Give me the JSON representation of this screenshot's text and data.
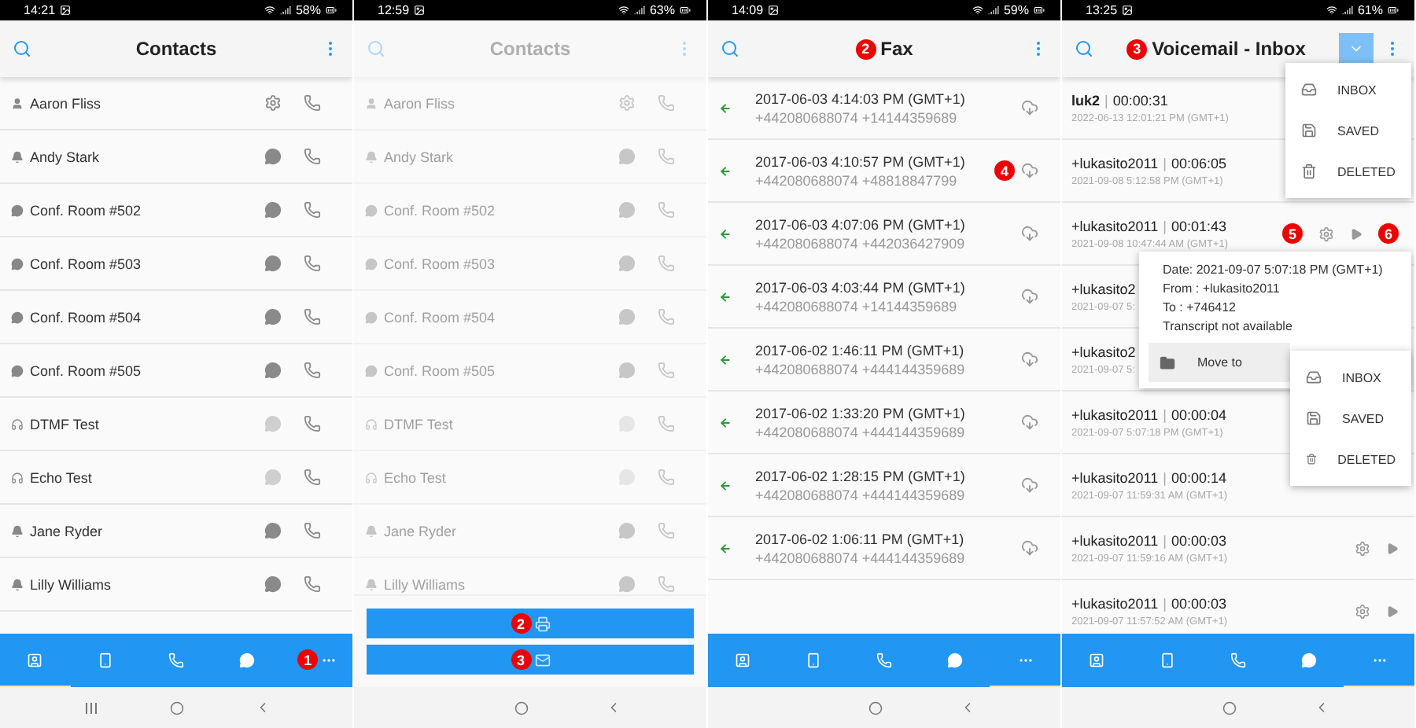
{
  "screens": [
    {
      "kind": "contacts",
      "status": {
        "time": "14:21",
        "battery": "58%"
      },
      "header": {
        "title": "Contacts"
      },
      "dimmed": false,
      "contacts": [
        {
          "name": "Aaron Fliss",
          "kind": "person",
          "action": {
            "kind": "settings",
            "enabled": true
          }
        },
        {
          "name": "Andy Stark",
          "kind": "bell",
          "action": {
            "kind": "chat",
            "enabled": true
          }
        },
        {
          "name": "Conf. Room #502",
          "kind": "chat",
          "action": {
            "kind": "chat",
            "enabled": true
          }
        },
        {
          "name": "Conf. Room #503",
          "kind": "chat",
          "action": {
            "kind": "chat",
            "enabled": true
          }
        },
        {
          "name": "Conf. Room #504",
          "kind": "chat",
          "action": {
            "kind": "chat",
            "enabled": true
          }
        },
        {
          "name": "Conf. Room #505",
          "kind": "chat",
          "action": {
            "kind": "chat",
            "enabled": true
          }
        },
        {
          "name": "DTMF Test",
          "kind": "headset",
          "action": {
            "kind": "chat",
            "enabled": false
          }
        },
        {
          "name": "Echo Test",
          "kind": "headset",
          "action": {
            "kind": "chat",
            "enabled": false
          }
        },
        {
          "name": "Jane Ryder",
          "kind": "bell",
          "action": {
            "kind": "chat",
            "enabled": true
          }
        },
        {
          "name": "Lilly Williams",
          "kind": "bell",
          "action": {
            "kind": "chat",
            "enabled": true
          }
        }
      ],
      "nav": [
        {
          "kind": "contacts",
          "selected": true
        },
        {
          "kind": "mobile",
          "selected": false
        },
        {
          "kind": "calls",
          "selected": false
        },
        {
          "kind": "chat",
          "selected": false
        },
        {
          "kind": "more",
          "selected": false,
          "badge": "1"
        }
      ],
      "system_nav": {
        "recents": true
      }
    },
    {
      "kind": "contacts",
      "status": {
        "time": "12:59",
        "battery": "63%"
      },
      "header": {
        "title": "Contacts"
      },
      "dimmed": true,
      "contacts": [
        {
          "name": "Aaron Fliss",
          "kind": "person",
          "action": {
            "kind": "settings",
            "enabled": true
          }
        },
        {
          "name": "Andy Stark",
          "kind": "bell",
          "action": {
            "kind": "chat",
            "enabled": true
          }
        },
        {
          "name": "Conf. Room #502",
          "kind": "chat",
          "action": {
            "kind": "chat",
            "enabled": true
          }
        },
        {
          "name": "Conf. Room #503",
          "kind": "chat",
          "action": {
            "kind": "chat",
            "enabled": true
          }
        },
        {
          "name": "Conf. Room #504",
          "kind": "chat",
          "action": {
            "kind": "chat",
            "enabled": true
          }
        },
        {
          "name": "Conf. Room #505",
          "kind": "chat",
          "action": {
            "kind": "chat",
            "enabled": true
          }
        },
        {
          "name": "DTMF Test",
          "kind": "headset",
          "action": {
            "kind": "chat",
            "enabled": false
          }
        },
        {
          "name": "Echo Test",
          "kind": "headset",
          "action": {
            "kind": "chat",
            "enabled": false
          }
        },
        {
          "name": "Jane Ryder",
          "kind": "bell",
          "action": {
            "kind": "chat",
            "enabled": true
          }
        },
        {
          "name": "Lilly Williams",
          "kind": "bell",
          "action": {
            "kind": "chat",
            "enabled": true
          }
        }
      ],
      "sheet": {
        "buttons": [
          {
            "kind": "fax",
            "badge": "2"
          },
          {
            "kind": "mail",
            "badge": "3"
          }
        ]
      },
      "system_nav": {
        "recents": false
      }
    },
    {
      "kind": "fax",
      "status": {
        "time": "14:09",
        "battery": "59%"
      },
      "header": {
        "title": "Fax",
        "badge": "2"
      },
      "faxes": [
        {
          "date": "2017-06-03 4:14:03 PM (GMT+1)",
          "numbers": "+442080688074 +14144359689"
        },
        {
          "date": "2017-06-03 4:10:57 PM (GMT+1)",
          "numbers": "+442080688074 +48818847799",
          "badge": "4"
        },
        {
          "date": "2017-06-03 4:07:06 PM (GMT+1)",
          "numbers": "+442080688074 +442036427909"
        },
        {
          "date": "2017-06-03 4:03:44 PM (GMT+1)",
          "numbers": "+442080688074 +14144359689"
        },
        {
          "date": "2017-06-02 1:46:11 PM (GMT+1)",
          "numbers": "+442080688074 +444144359689"
        },
        {
          "date": "2017-06-02 1:33:20 PM (GMT+1)",
          "numbers": "+442080688074 +444144359689"
        },
        {
          "date": "2017-06-02 1:28:15 PM (GMT+1)",
          "numbers": "+442080688074 +444144359689"
        },
        {
          "date": "2017-06-02 1:06:11 PM (GMT+1)",
          "numbers": "+442080688074 +444144359689"
        }
      ],
      "nav": [
        {
          "kind": "contacts",
          "selected": false
        },
        {
          "kind": "mobile",
          "selected": false
        },
        {
          "kind": "calls",
          "selected": false
        },
        {
          "kind": "chat",
          "selected": false
        },
        {
          "kind": "more",
          "selected": true
        }
      ],
      "system_nav": {
        "recents": false
      }
    },
    {
      "kind": "voicemail",
      "status": {
        "time": "13:25",
        "battery": "61%"
      },
      "header": {
        "title": "Voicemail - Inbox",
        "badge": "3",
        "dropdown_open": true
      },
      "messages": [
        {
          "caller": "luk2",
          "separator": "|",
          "duration": "00:00:31",
          "date": "2022-06-13 12:01:21 PM (GMT+1)",
          "unread": true
        },
        {
          "caller": "+lukasito2011",
          "separator": "|",
          "duration": "00:06:05",
          "date": "2021-09-08 5:12:58 PM (GMT+1)",
          "unread": false
        },
        {
          "caller": "+lukasito2011",
          "separator": "|",
          "duration": "00:01:43",
          "date": "2021-09-08 10:47:44 AM (GMT+1)",
          "unread": false,
          "actions": true,
          "gear_badge": "5",
          "play_badge": "6"
        },
        {
          "caller": "+lukasito2",
          "date": "2021-09-07 5:",
          "unread": false
        },
        {
          "caller": "+lukasito2",
          "date": "2021-09-07 5:",
          "unread": false
        },
        {
          "caller": "+lukasito2011",
          "separator": "|",
          "duration": "00:00:04",
          "date": "2021-09-07 5:07:18 PM (GMT+1)",
          "unread": false
        },
        {
          "caller": "+lukasito2011",
          "separator": "|",
          "duration": "00:00:14",
          "date": "2021-09-07 11:59:31 AM (GMT+1)",
          "unread": false
        },
        {
          "caller": "+lukasito2011",
          "separator": "|",
          "duration": "00:00:03",
          "date": "2021-09-07 11:59:16 AM (GMT+1)",
          "unread": false,
          "actions": true
        },
        {
          "caller": "+lukasito2011",
          "separator": "|",
          "duration": "00:00:03",
          "date": "2021-09-07 11:57:52 AM (GMT+1)",
          "unread": false,
          "actions": true
        }
      ],
      "folder_menu": [
        {
          "kind": "inbox",
          "label": "INBOX"
        },
        {
          "kind": "saved",
          "label": "SAVED"
        },
        {
          "kind": "deleted",
          "label": "DELETED"
        }
      ],
      "details": {
        "lines": [
          "Date: 2021-09-07 5:07:18 PM (GMT+1)",
          "From : +lukasito2011",
          "To : +746412",
          "Transcript not available"
        ],
        "move_label": "Move to",
        "submenu": [
          {
            "kind": "inbox",
            "label": "INBOX"
          },
          {
            "kind": "saved",
            "label": "SAVED"
          },
          {
            "kind": "deleted",
            "label": "DELETED"
          }
        ]
      },
      "nav": [
        {
          "kind": "contacts",
          "selected": false
        },
        {
          "kind": "mobile",
          "selected": false
        },
        {
          "kind": "calls",
          "selected": false
        },
        {
          "kind": "chat",
          "selected": false
        },
        {
          "kind": "more",
          "selected": true
        }
      ],
      "system_nav": {
        "recents": false
      }
    }
  ]
}
